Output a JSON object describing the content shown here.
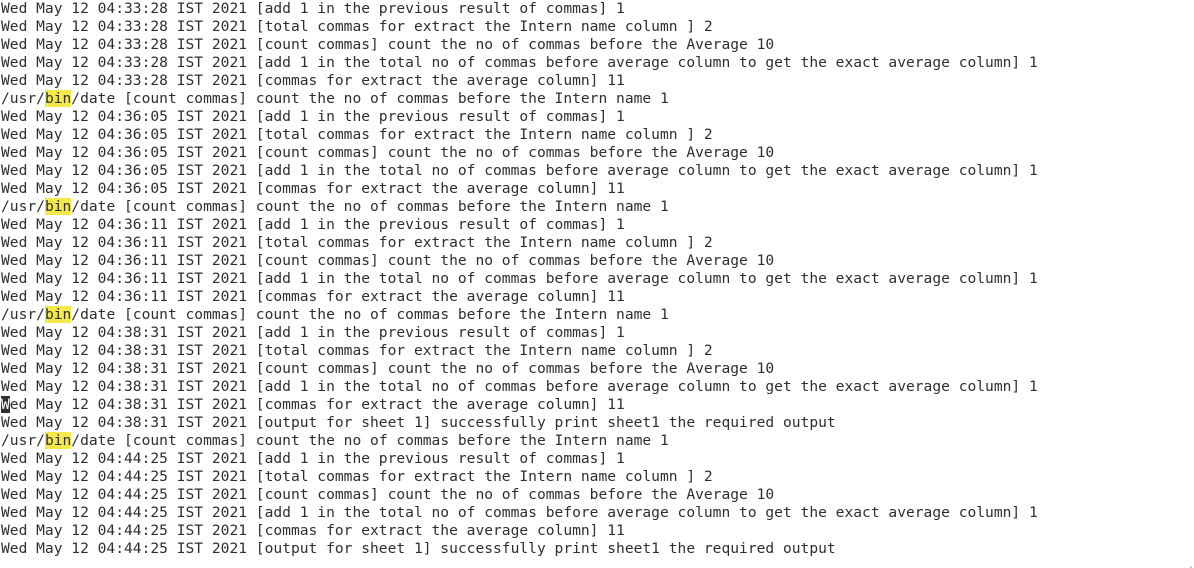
{
  "terminal": {
    "highlight_color": "#f5e84a",
    "lines": [
      {
        "pre": "Wed May 12 04:33:28 IST 2021 [add 1 in the previous result of commas] 1"
      },
      {
        "pre": "Wed May 12 04:33:28 IST 2021 [total commas for extract the Intern name column ] 2"
      },
      {
        "pre": "Wed May 12 04:33:28 IST 2021 [count commas] count the no of commas before the Average 10"
      },
      {
        "pre": "Wed May 12 04:33:28 IST 2021 [add 1 in the total no of commas before average column to get the exact average column] 1"
      },
      {
        "pre": "Wed May 12 04:33:28 IST 2021 [commas for extract the average column] 11"
      },
      {
        "pre": "/usr/",
        "hl": "bin",
        "post": "/date [count commas] count the no of commas before the Intern name 1"
      },
      {
        "pre": "Wed May 12 04:36:05 IST 2021 [add 1 in the previous result of commas] 1"
      },
      {
        "pre": "Wed May 12 04:36:05 IST 2021 [total commas for extract the Intern name column ] 2"
      },
      {
        "pre": "Wed May 12 04:36:05 IST 2021 [count commas] count the no of commas before the Average 10"
      },
      {
        "pre": "Wed May 12 04:36:05 IST 2021 [add 1 in the total no of commas before average column to get the exact average column] 1"
      },
      {
        "pre": "Wed May 12 04:36:05 IST 2021 [commas for extract the average column] 11"
      },
      {
        "pre": "/usr/",
        "hl": "bin",
        "post": "/date [count commas] count the no of commas before the Intern name 1"
      },
      {
        "pre": "Wed May 12 04:36:11 IST 2021 [add 1 in the previous result of commas] 1"
      },
      {
        "pre": "Wed May 12 04:36:11 IST 2021 [total commas for extract the Intern name column ] 2"
      },
      {
        "pre": "Wed May 12 04:36:11 IST 2021 [count commas] count the no of commas before the Average 10"
      },
      {
        "pre": "Wed May 12 04:36:11 IST 2021 [add 1 in the total no of commas before average column to get the exact average column] 1"
      },
      {
        "pre": "Wed May 12 04:36:11 IST 2021 [commas for extract the average column] 11"
      },
      {
        "pre": "/usr/",
        "hl": "bin",
        "post": "/date [count commas] count the no of commas before the Intern name 1"
      },
      {
        "pre": "Wed May 12 04:38:31 IST 2021 [add 1 in the previous result of commas] 1"
      },
      {
        "pre": "Wed May 12 04:38:31 IST 2021 [total commas for extract the Intern name column ] 2"
      },
      {
        "pre": "Wed May 12 04:38:31 IST 2021 [count commas] count the no of commas before the Average 10"
      },
      {
        "pre": "Wed May 12 04:38:31 IST 2021 [add 1 in the total no of commas before average column to get the exact average column] 1"
      },
      {
        "cursor": "W",
        "post": "ed May 12 04:38:31 IST 2021 [commas for extract the average column] 11"
      },
      {
        "pre": "Wed May 12 04:38:31 IST 2021 [output for sheet 1] successfully print sheet1 the required output"
      },
      {
        "pre": "/usr/",
        "hl": "bin",
        "post": "/date [count commas] count the no of commas before the Intern name 1"
      },
      {
        "pre": "Wed May 12 04:44:25 IST 2021 [add 1 in the previous result of commas] 1"
      },
      {
        "pre": "Wed May 12 04:44:25 IST 2021 [total commas for extract the Intern name column ] 2"
      },
      {
        "pre": "Wed May 12 04:44:25 IST 2021 [count commas] count the no of commas before the Average 10"
      },
      {
        "pre": "Wed May 12 04:44:25 IST 2021 [add 1 in the total no of commas before average column to get the exact average column] 1"
      },
      {
        "pre": "Wed May 12 04:44:25 IST 2021 [commas for extract the average column] 11"
      },
      {
        "pre": "Wed May 12 04:44:25 IST 2021 [output for sheet 1] successfully print sheet1 the required output"
      }
    ]
  }
}
